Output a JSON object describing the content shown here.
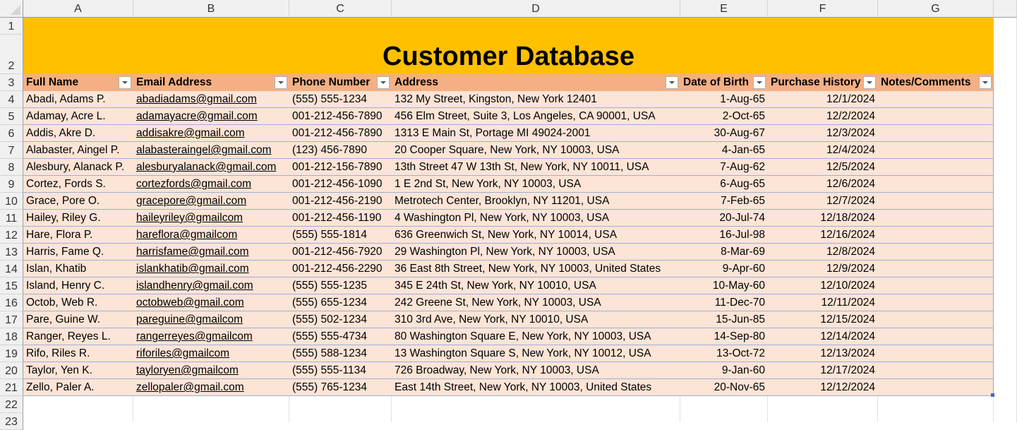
{
  "columns": [
    "A",
    "B",
    "C",
    "D",
    "E",
    "F",
    "G"
  ],
  "title": "Customer Database",
  "headers": [
    "Full Name",
    "Email Address",
    "Phone Number",
    "Address",
    "Date of Birth",
    "Purchase History",
    "Notes/Comments"
  ],
  "rows": [
    [
      "Abadi, Adams P.",
      "abadiadams@gmail.com",
      "(555) 555-1234",
      "132 My Street, Kingston, New York 12401",
      "1-Aug-65",
      "12/1/2024",
      ""
    ],
    [
      "Adamay, Acre L.",
      "adamayacre@gmail.com",
      "001-212-456-7890",
      "456 Elm Street, Suite 3, Los Angeles, CA 90001, USA",
      "2-Oct-65",
      "12/2/2024",
      ""
    ],
    [
      "Addis, Akre D.",
      "addisakre@gmail.com",
      "001-212-456-7890",
      "1313 E Main St, Portage MI 49024-2001",
      "30-Aug-67",
      "12/3/2024",
      ""
    ],
    [
      "Alabaster, Aingel P.",
      "alabasteraingel@gmail.com",
      "(123) 456-7890",
      "20 Cooper Square, New York, NY 10003, USA",
      "4-Jan-65",
      "12/4/2024",
      ""
    ],
    [
      "Alesbury, Alanack P.",
      "alesburyalanack@gmail.com",
      "001-212-156-7890",
      "13th Street 47 W 13th St, New York, NY 10011, USA",
      "7-Aug-62",
      "12/5/2024",
      ""
    ],
    [
      "Cortez, Fords S.",
      "cortezfords@gmail.com",
      "001-212-456-1090",
      "1 E 2nd St, New York, NY 10003, USA",
      "6-Aug-65",
      "12/6/2024",
      ""
    ],
    [
      "Grace, Pore O.",
      "gracepore@gmail.com",
      "001-212-456-2190",
      "Metrotech Center, Brooklyn, NY 11201, USA",
      "7-Feb-65",
      "12/7/2024",
      ""
    ],
    [
      "Hailey, Riley G.",
      "haileyriley@gmailcom",
      "001-212-456-1190",
      "4 Washington Pl, New York, NY 10003, USA",
      "20-Jul-74",
      "12/18/2024",
      ""
    ],
    [
      "Hare, Flora P.",
      "hareflora@gmailcom",
      "(555) 555-1814",
      "636 Greenwich St, New York, NY 10014, USA",
      "16-Jul-98",
      "12/16/2024",
      ""
    ],
    [
      "Harris, Fame Q.",
      "harrisfame@gmail.com",
      "001-212-456-7920",
      "29 Washington Pl, New York, NY 10003, USA",
      "8-Mar-69",
      "12/8/2024",
      ""
    ],
    [
      "Islan, Khatib",
      "islankhatib@gmail.com",
      "001-212-456-2290",
      "36 East 8th Street, New York, NY 10003, United States",
      "9-Apr-60",
      "12/9/2024",
      ""
    ],
    [
      "Island, Henry C.",
      "islandhenry@gmail.com",
      "(555) 555-1235",
      "345 E 24th St, New York, NY 10010, USA",
      "10-May-60",
      "12/10/2024",
      ""
    ],
    [
      "Octob, Web R.",
      "octobweb@gmail.com",
      "(555) 655-1234",
      "242 Greene St, New York, NY 10003, USA",
      "11-Dec-70",
      "12/11/2024",
      ""
    ],
    [
      "Pare, Guine W.",
      "pareguine@gmailcom",
      "(555) 502-1234",
      "310 3rd Ave, New York, NY 10010, USA",
      "15-Jun-85",
      "12/15/2024",
      ""
    ],
    [
      "Ranger, Reyes L.",
      "rangerreyes@gmailcom",
      "(555) 555-4734",
      "80 Washington Square E, New York, NY 10003, USA",
      "14-Sep-80",
      "12/14/2024",
      ""
    ],
    [
      "Rifo, Riles R.",
      "riforiles@gmailcom",
      "(555) 588-1234",
      "13 Washington Square S, New York, NY 10012, USA",
      "13-Oct-72",
      "12/13/2024",
      ""
    ],
    [
      "Taylor, Yen K.",
      "tayloryen@gmailcom",
      "(555) 555-1134",
      "726 Broadway, New York, NY 10003, USA",
      "9-Jan-60",
      "12/17/2024",
      ""
    ],
    [
      "Zello, Paler A.",
      "zellopaler@gmail.com",
      "(555) 765-1234",
      "East 14th Street, New York, NY 10003, United States",
      "20-Nov-65",
      "12/12/2024",
      ""
    ]
  ],
  "colors": {
    "title_fill": "#FFC000",
    "header_fill": "#F4B084",
    "row_fill": "#FCE4D6"
  }
}
